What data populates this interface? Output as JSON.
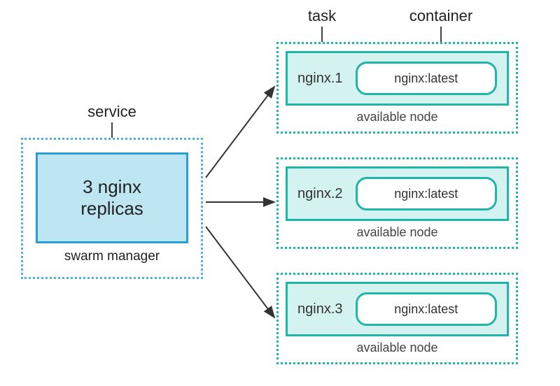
{
  "labels": {
    "service": "service",
    "task": "task",
    "container": "container"
  },
  "manager": {
    "service_text_line1": "3 nginx",
    "service_text_line2": "replicas",
    "caption": "swarm manager"
  },
  "nodes": [
    {
      "task": "nginx.1",
      "container": "nginx:latest",
      "caption": "available node"
    },
    {
      "task": "nginx.2",
      "container": "nginx:latest",
      "caption": "available node"
    },
    {
      "task": "nginx.3",
      "container": "nginx:latest",
      "caption": "available node"
    }
  ],
  "colors": {
    "blue_border": "#2a9fd6",
    "blue_fill": "#bde5f2",
    "blue_dotted": "#4fb3d9",
    "teal_border": "#1fb5a7",
    "teal_fill": "#d4f3f0"
  }
}
